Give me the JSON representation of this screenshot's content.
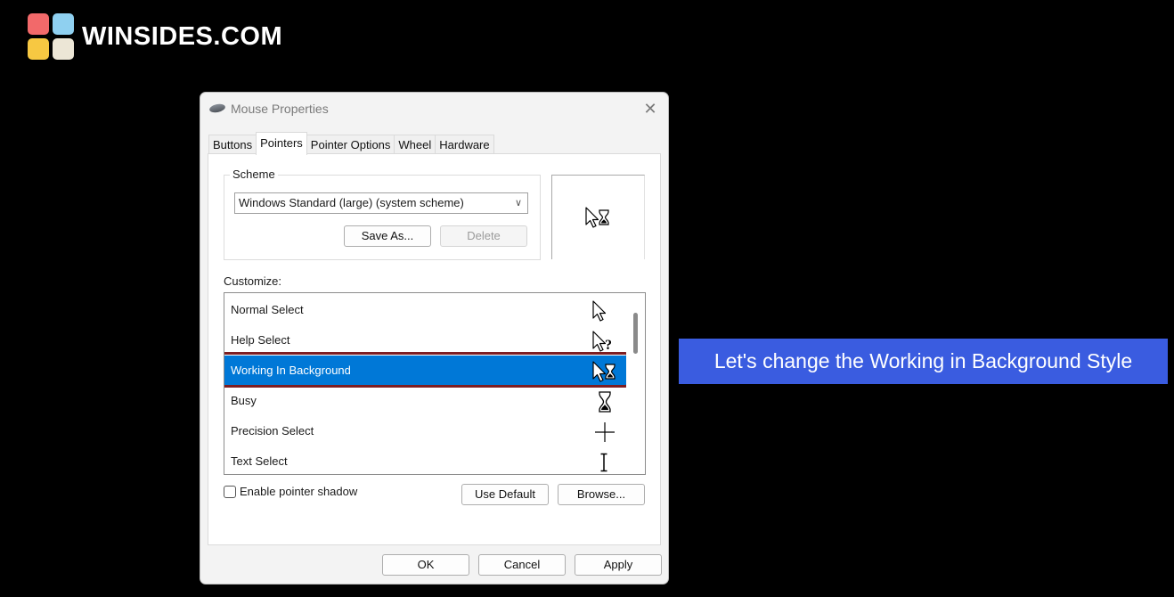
{
  "logo": {
    "text": "WINSIDES.COM"
  },
  "dialog": {
    "title": "Mouse Properties",
    "close_symbol": "✕",
    "tabs": [
      {
        "label": "Buttons",
        "active": false
      },
      {
        "label": "Pointers",
        "active": true
      },
      {
        "label": "Pointer Options",
        "active": false
      },
      {
        "label": "Wheel",
        "active": false
      },
      {
        "label": "Hardware",
        "active": false
      }
    ],
    "scheme": {
      "legend": "Scheme",
      "selected": "Windows Standard (large) (system scheme)",
      "save_as_label": "Save As...",
      "delete_label": "Delete"
    },
    "customize": {
      "label": "Customize:",
      "items": [
        {
          "label": "Normal Select",
          "icon": "arrow-cursor-icon"
        },
        {
          "label": "Help Select",
          "icon": "help-cursor-icon",
          "glyph": "?"
        },
        {
          "label": "Working In Background",
          "icon": "working-cursor-icon",
          "selected": true
        },
        {
          "label": "Busy",
          "icon": "hourglass-cursor-icon"
        },
        {
          "label": "Precision Select",
          "icon": "crosshair-cursor-icon"
        },
        {
          "label": "Text Select",
          "icon": "ibeam-cursor-icon"
        }
      ]
    },
    "shadow_label": "Enable pointer shadow",
    "use_default_label": "Use Default",
    "browse_label": "Browse...",
    "ok_label": "OK",
    "cancel_label": "Cancel",
    "apply_label": "Apply"
  },
  "callout": {
    "text": "Let's change the Working in Background Style"
  },
  "colors": {
    "selection": "#0078d7",
    "highlight_border": "#7d1e22",
    "callout_bg": "#3a5ce0"
  }
}
